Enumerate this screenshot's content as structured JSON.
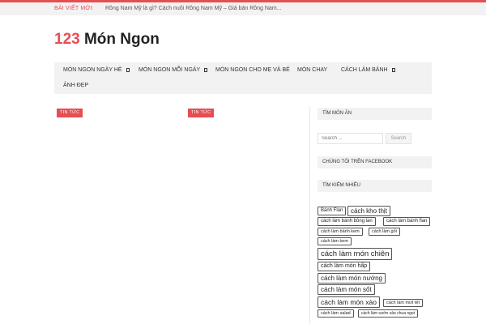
{
  "ticker": {
    "label": "BÀI VIẾT MỚI:",
    "text": "Rồng Nam Mỹ là gì? Cách nuôi Rồng Nam Mỹ – Giá bán Rồng Nam..."
  },
  "logo": {
    "number": "123",
    "name": "Món Ngon"
  },
  "nav": {
    "items": [
      {
        "label": "MÓN NGON NGÀY HÈ",
        "has_dropdown": true
      },
      {
        "label": "MÓN NGON MỖI NGÀY",
        "has_dropdown": true
      },
      {
        "label": "MÓN NGON CHO MẸ VÀ BÉ",
        "has_dropdown": false
      },
      {
        "label": "MÓN CHAY",
        "has_dropdown": false
      },
      {
        "label": "CÁCH LÀM BÁNH",
        "has_dropdown": true
      },
      {
        "label": "ẢNH ĐẸP",
        "has_dropdown": false
      }
    ]
  },
  "posts": [
    {
      "badge": "TIN TỨC"
    },
    {
      "badge": "TIN TỨC"
    }
  ],
  "sidebar": {
    "search_title": "TÌM MÓN ĂN",
    "search_placeholder": "Search ...",
    "search_button": "Search",
    "facebook_title": "CHÚNG TÔI TRÊN FACEBOOK",
    "tags_title": "TÌM KIẾM NHIỀU",
    "tags": [
      "Bánh Flan",
      "cách kho thịt",
      "cách làm bánh bông lan",
      "cách làm bánh flan",
      "cách làm bánh kem",
      "cách làm gỏi",
      "cách làm kem",
      "cách làm món chiên",
      "cách làm món hấp",
      "cách làm món nướng",
      "cách làm món sốt",
      "cách làm món xào",
      "cách làm mứt tết",
      "cách làm salad",
      "cách làm sườn xào chua ngọt"
    ]
  },
  "colors": {
    "accent": "#e54e53",
    "nav_bg": "#f2f2f2",
    "text": "#222222"
  },
  "icons": {
    "dropdown": "dropdown-square-icon"
  }
}
